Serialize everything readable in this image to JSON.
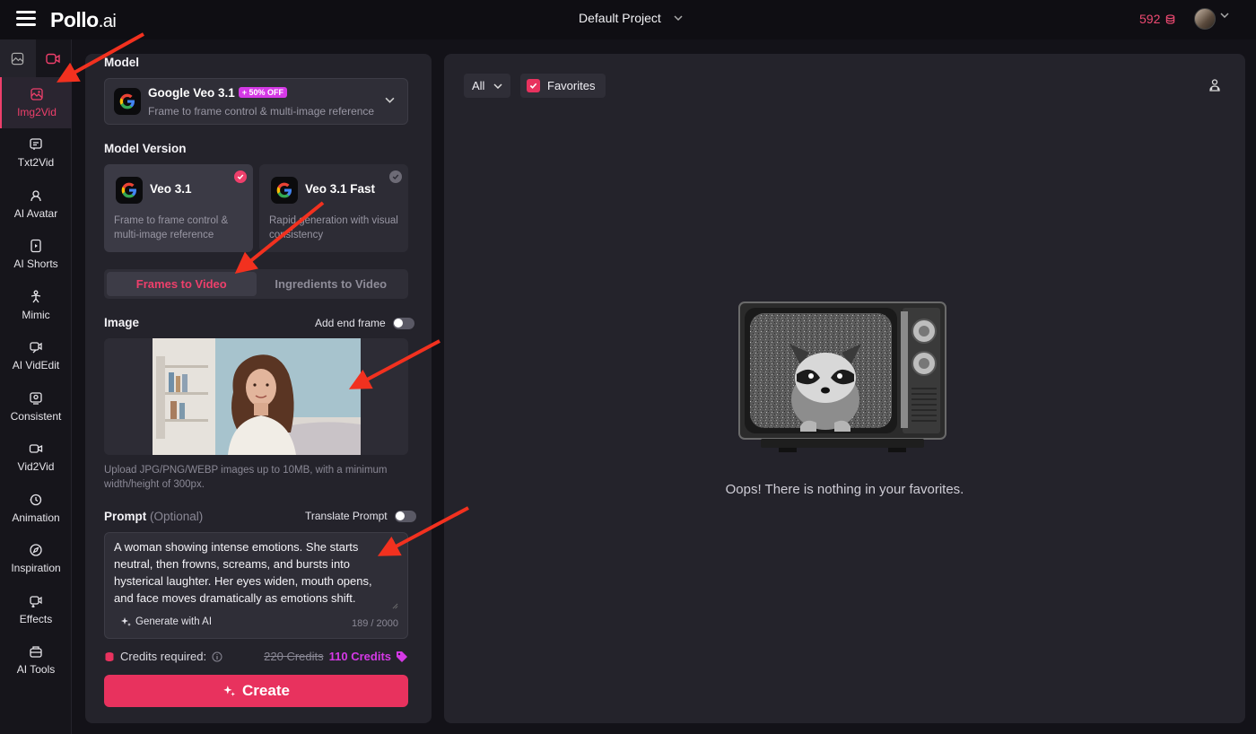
{
  "header": {
    "logo_main": "Pollo",
    "logo_suffix": ".ai",
    "project": "Default Project",
    "credits": "592"
  },
  "sidebar": {
    "items": [
      {
        "label": "Img2Vid",
        "icon": "image-video-icon"
      },
      {
        "label": "Txt2Vid",
        "icon": "text-video-icon"
      },
      {
        "label": "AI Avatar",
        "icon": "avatar-icon"
      },
      {
        "label": "AI Shorts",
        "icon": "shorts-icon"
      },
      {
        "label": "Mimic",
        "icon": "mimic-icon"
      },
      {
        "label": "AI VidEdit",
        "icon": "video-edit-icon"
      },
      {
        "label": "Consistent",
        "icon": "consistent-icon"
      },
      {
        "label": "Vid2Vid",
        "icon": "vid2vid-icon"
      },
      {
        "label": "Animation",
        "icon": "animation-icon"
      },
      {
        "label": "Inspiration",
        "icon": "compass-icon"
      },
      {
        "label": "Effects",
        "icon": "effects-icon"
      },
      {
        "label": "AI Tools",
        "icon": "tools-icon"
      }
    ]
  },
  "form": {
    "model_label": "Model",
    "model_name": "Google Veo 3.1",
    "model_badge": "+ 50% OFF",
    "model_desc": "Frame to frame control & multi-image reference",
    "version_label": "Model Version",
    "versions": [
      {
        "name": "Veo 3.1",
        "desc": "Frame to frame control & multi-image reference",
        "selected": true
      },
      {
        "name": "Veo 3.1 Fast",
        "desc": "Rapid generation with visual consistency",
        "selected": false
      }
    ],
    "modes": [
      "Frames to Video",
      "Ingredients to Video"
    ],
    "image_label": "Image",
    "end_frame_label": "Add end frame",
    "upload_hint": "Upload JPG/PNG/WEBP images up to 10MB, with a minimum width/height of 300px.",
    "prompt_label": "Prompt",
    "prompt_optional": "(Optional)",
    "translate_label": "Translate Prompt",
    "prompt_text": "A woman showing intense emotions. She starts neutral, then frowns, screams, and bursts into hysterical laughter. Her eyes widen, mouth opens, and face moves dramatically as emotions shift.",
    "generate_ai": "Generate with AI",
    "counter": "189 / 2000",
    "credits_label": "Credits required:",
    "credits_old": "220 Credits",
    "credits_new": "110 Credits",
    "create": "Create"
  },
  "main": {
    "filter": "All",
    "favorites": "Favorites",
    "empty": "Oops! There is nothing in your favorites."
  },
  "colors": {
    "accent": "#e8325e",
    "promo": "#d539e6",
    "bg": "#24232b"
  }
}
